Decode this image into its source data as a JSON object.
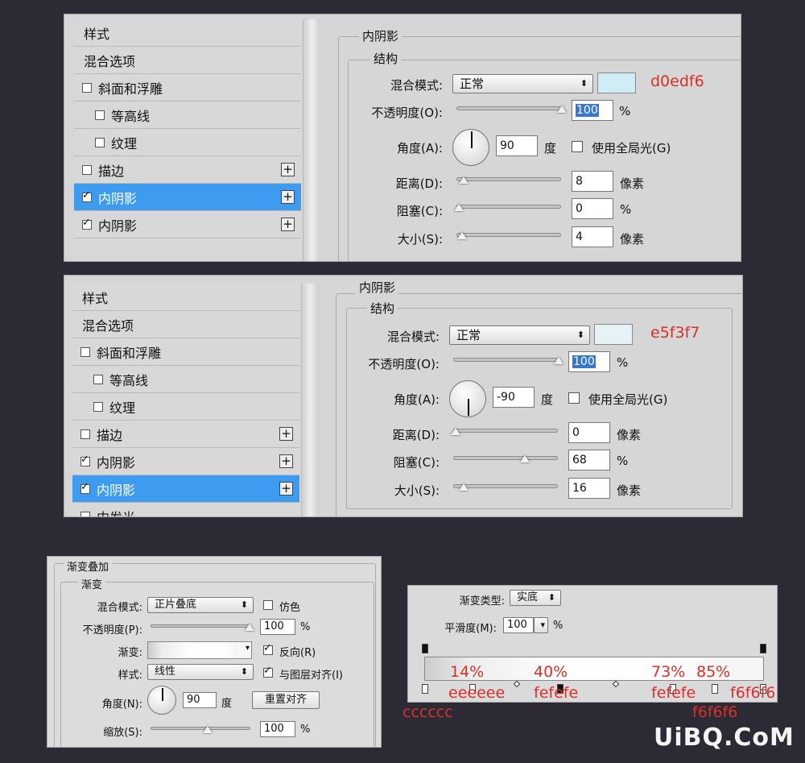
{
  "panel1": {
    "sidebar": [
      "样式",
      "混合选项",
      "斜面和浮雕",
      "等高线",
      "纹理",
      "描边",
      "内阴影",
      "内阴影"
    ],
    "section_title": "内阴影",
    "group_title": "结构",
    "blend_mode_label": "混合模式:",
    "blend_mode_value": "正常",
    "color_note": "d0edf6",
    "color_hex": "#d0edf6",
    "opacity_label": "不透明度(O):",
    "opacity_value": "100",
    "percent": "%",
    "angle_label": "角度(A):",
    "angle_value": "90",
    "degree": "度",
    "global_light": "使用全局光(G)",
    "distance_label": "距离(D):",
    "distance_value": "8",
    "choke_label": "阻塞(C):",
    "choke_value": "0",
    "size_label": "大小(S):",
    "size_value": "4",
    "px": "像素"
  },
  "panel2": {
    "sidebar": [
      "样式",
      "混合选项",
      "斜面和浮雕",
      "等高线",
      "纹理",
      "描边",
      "内阴影",
      "内阴影",
      "内发光"
    ],
    "section_title": "内阴影",
    "group_title": "结构",
    "blend_mode_label": "混合模式:",
    "blend_mode_value": "正常",
    "color_note": "e5f3f7",
    "color_hex": "#e5f3f7",
    "opacity_label": "不透明度(O):",
    "opacity_value": "100",
    "percent": "%",
    "angle_label": "角度(A):",
    "angle_value": "-90",
    "degree": "度",
    "global_light": "使用全局光(G)",
    "distance_label": "距离(D):",
    "distance_value": "0",
    "choke_label": "阻塞(C):",
    "choke_value": "68",
    "size_label": "大小(S):",
    "size_value": "16",
    "px": "像素"
  },
  "panel3": {
    "section_title": "渐变叠加",
    "group_title": "渐变",
    "blend_mode_label": "混合模式:",
    "blend_mode_value": "正片叠底",
    "dither": "仿色",
    "opacity_label": "不透明度(P):",
    "opacity_value": "100",
    "percent": "%",
    "gradient_label": "渐变:",
    "reverse": "反向(R)",
    "style_label": "样式:",
    "style_value": "线性",
    "align_layer": "与图层对齐(I)",
    "angle_label": "角度(N):",
    "angle_value": "90",
    "degree": "度",
    "reset_align": "重置对齐",
    "scale_label": "缩放(S):",
    "scale_value": "100"
  },
  "panel4": {
    "type_label": "渐变类型:",
    "type_value": "实底",
    "smooth_label": "平滑度(M):",
    "smooth_value": "100",
    "percent": "%",
    "stops": [
      {
        "color": "cccccc",
        "location": ""
      },
      {
        "color": "eeeeee",
        "location": "14%"
      },
      {
        "color": "fefefe",
        "location": "40%"
      },
      {
        "color": "fefefe",
        "location": "73%"
      },
      {
        "color": "f6f6f6",
        "location": "85%"
      },
      {
        "color": "f6f6f6",
        "location": ""
      }
    ]
  },
  "watermark": "UiBQ.CoM"
}
